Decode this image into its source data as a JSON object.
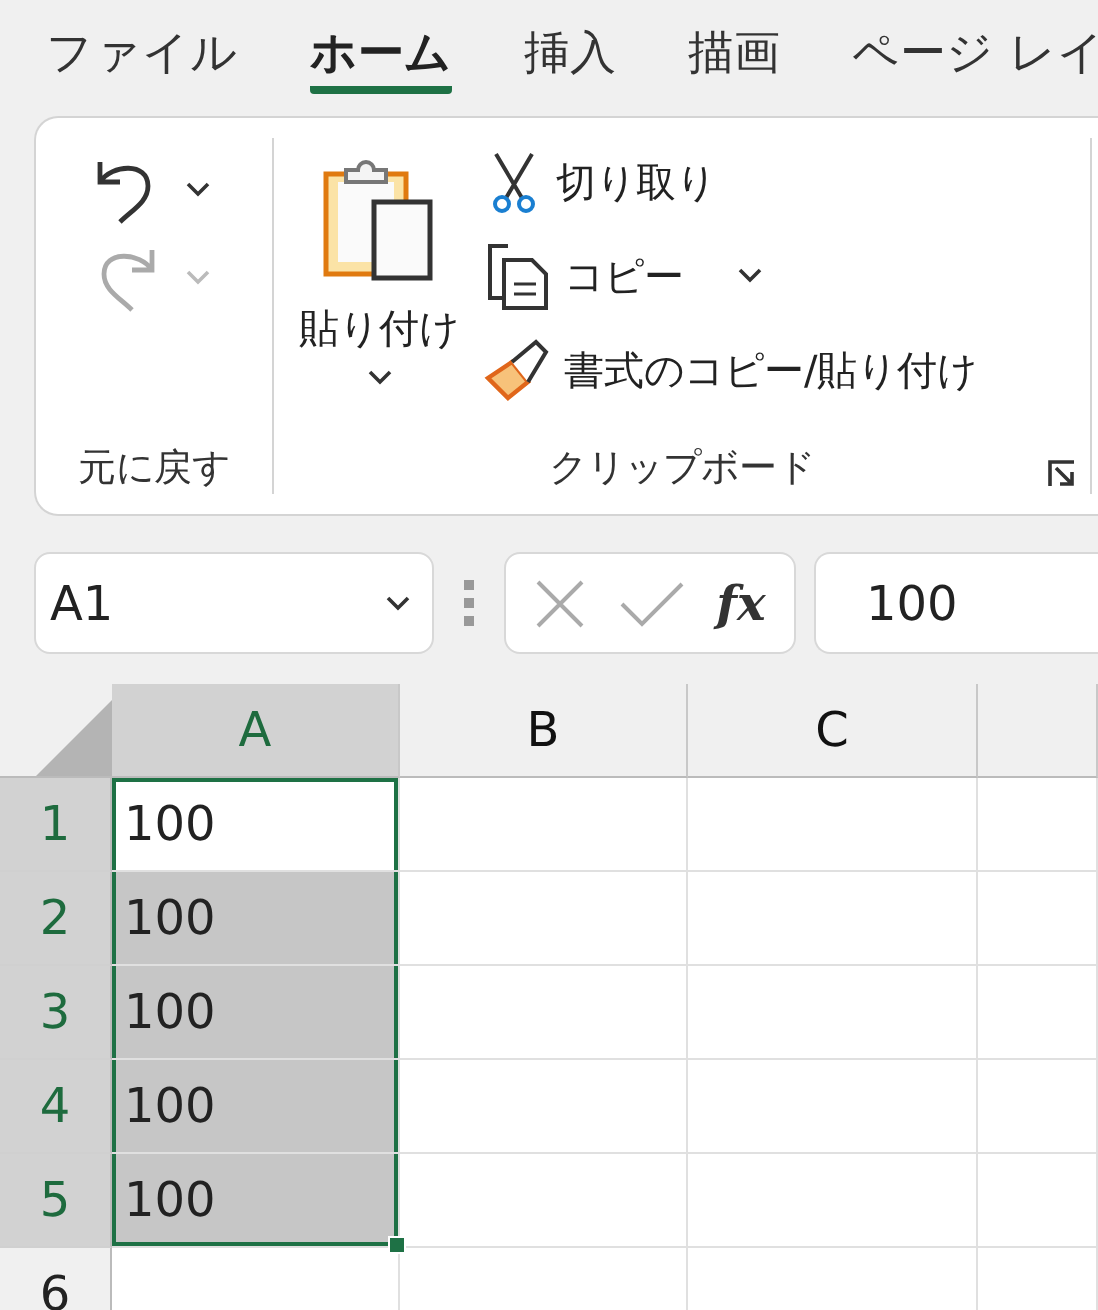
{
  "tabs": [
    {
      "label": "ファイル",
      "selected": false
    },
    {
      "label": "ホーム",
      "selected": true
    },
    {
      "label": "挿入",
      "selected": false
    },
    {
      "label": "描画",
      "selected": false
    },
    {
      "label": "ページ レイ",
      "selected": false
    }
  ],
  "ribbon": {
    "undo_group": {
      "label": "元に戻す",
      "undo": {
        "disabled": false
      },
      "redo": {
        "disabled": true
      }
    },
    "clipboard_group": {
      "label": "クリップボード",
      "paste": "貼り付け",
      "cut": "切り取り",
      "copy": "コピー",
      "format_painter": "書式のコピー/貼り付け"
    }
  },
  "formula_bar": {
    "name_box": "A1",
    "function_label": "fx",
    "value": "100"
  },
  "grid": {
    "columns": [
      {
        "label": "A",
        "selected": true
      },
      {
        "label": "B",
        "selected": false
      },
      {
        "label": "C",
        "selected": false
      }
    ],
    "rows": [
      {
        "label": "1",
        "selected": true,
        "active": true,
        "value": "100"
      },
      {
        "label": "2",
        "selected": true,
        "active": false,
        "value": "100"
      },
      {
        "label": "3",
        "selected": true,
        "active": false,
        "value": "100"
      },
      {
        "label": "4",
        "selected": true,
        "active": false,
        "value": "100"
      },
      {
        "label": "5",
        "selected": true,
        "active": false,
        "value": "100"
      },
      {
        "label": "6",
        "selected": false,
        "active": false
      }
    ]
  }
}
